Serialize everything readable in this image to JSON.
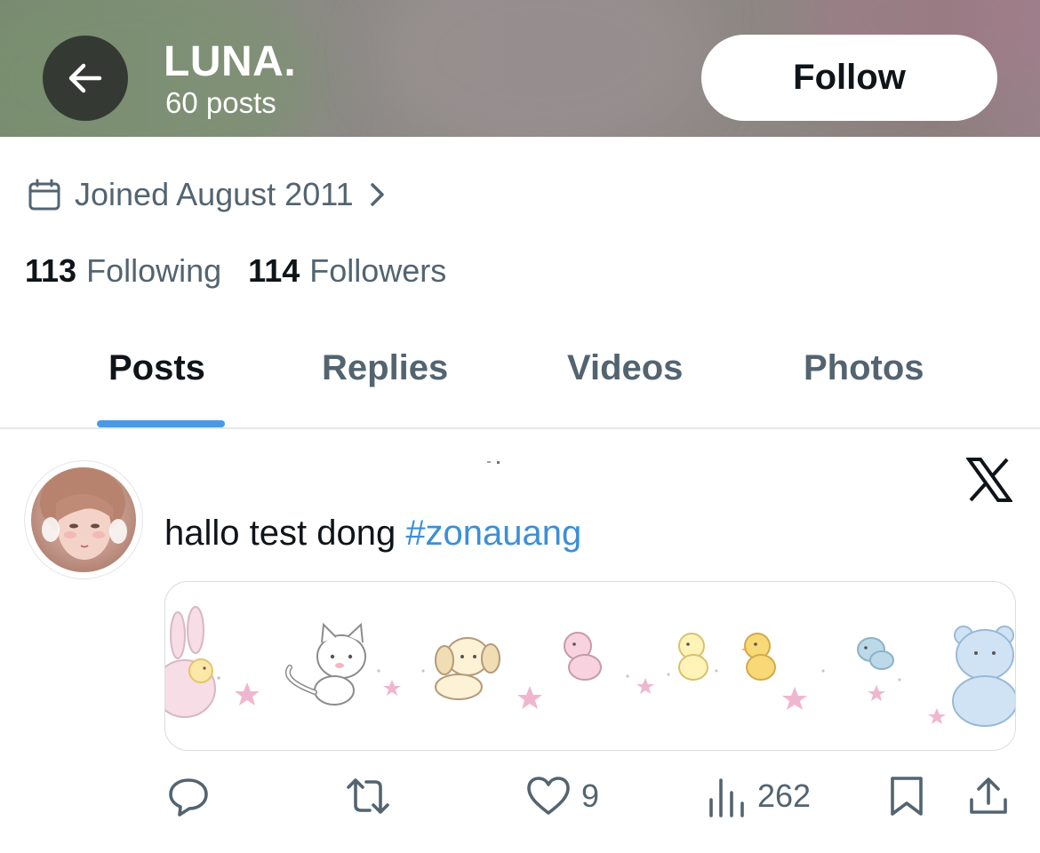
{
  "header": {
    "title": "LUNA.",
    "subtitle": "60 posts",
    "follow_label": "Follow",
    "back_icon": "arrow-left-icon"
  },
  "profile": {
    "joined": "Joined August 2011",
    "following_count": "113",
    "following_label": "Following",
    "followers_count": "114",
    "followers_label": "Followers"
  },
  "tabs": [
    {
      "label": "Posts",
      "active": true
    },
    {
      "label": "Replies",
      "active": false
    },
    {
      "label": "Videos",
      "active": false
    },
    {
      "label": "Photos",
      "active": false
    }
  ],
  "post": {
    "text": "hallo test dong ",
    "hashtag": "#zonauang",
    "actions": {
      "reply_count": "",
      "repost_count": "",
      "like_count": "9",
      "views_count": "262"
    }
  },
  "colors": {
    "accent": "#4a99e9",
    "hashtag": "#3c8fd6",
    "secondary_text": "#536471",
    "primary_text": "#0f1419"
  }
}
